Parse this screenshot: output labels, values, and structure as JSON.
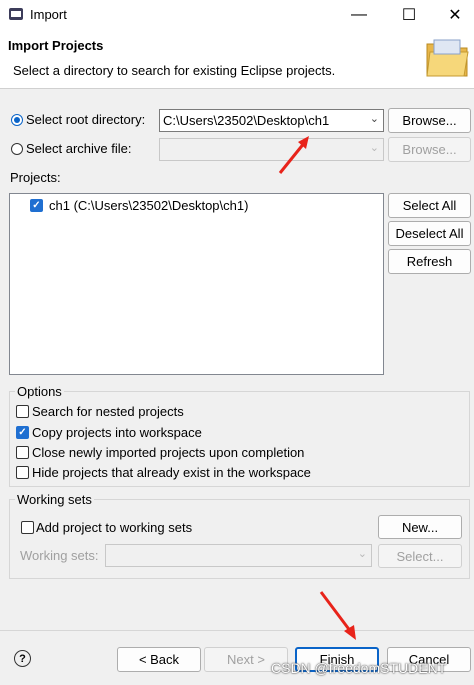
{
  "window": {
    "title": "Import",
    "minimize_glyph": "—",
    "maximize_glyph": "☐",
    "close_glyph": "✕"
  },
  "header": {
    "title": "Import Projects",
    "description": "Select a directory to search for existing Eclipse projects.",
    "icon": "folder-icon"
  },
  "source": {
    "root_label": "Select root directory:",
    "root_value": "C:\\Users\\23502\\Desktop\\ch1",
    "root_selected": true,
    "archive_label": "Select archive file:",
    "archive_value": "",
    "browse_label": "Browse...",
    "browse_archive_label": "Browse..."
  },
  "projects": {
    "label": "Projects:",
    "items": [
      {
        "label": "ch1 (C:\\Users\\23502\\Desktop\\ch1)",
        "checked": true
      }
    ],
    "select_all_label": "Select All",
    "deselect_all_label": "Deselect All",
    "refresh_label": "Refresh"
  },
  "options": {
    "label": "Options",
    "items": [
      {
        "label": "Search for nested projects",
        "checked": false
      },
      {
        "label": "Copy projects into workspace",
        "checked": true
      },
      {
        "label": "Close newly imported projects upon completion",
        "checked": false
      },
      {
        "label": "Hide projects that already exist in the workspace",
        "checked": false
      }
    ]
  },
  "working_sets": {
    "label": "Working sets",
    "add_label": "Add project to working sets",
    "add_checked": false,
    "new_label": "New...",
    "sets_label": "Working sets:",
    "sets_value": "",
    "select_label": "Select..."
  },
  "footer": {
    "help_glyph": "?",
    "back_label": "< Back",
    "next_label": "Next >",
    "finish_label": "Finish",
    "cancel_label": "Cancel"
  },
  "watermark": "CSDN @freedomSTUDENT",
  "colors": {
    "accent": "#1f6fd1",
    "annotation_arrow": "#e8231a"
  }
}
